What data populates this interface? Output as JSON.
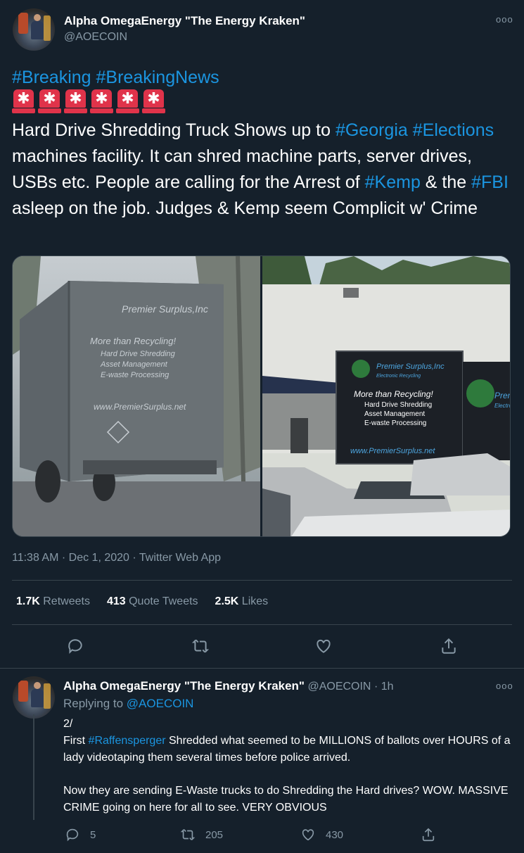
{
  "tweet": {
    "display_name": "Alpha OmegaEnergy \"The Energy Kraken\"",
    "handle": "@AOECOIN",
    "more": "ooo",
    "hashtags_line": [
      "#Breaking",
      "#BreakingNews"
    ],
    "alarm_emoji_count": 6,
    "body_parts": [
      {
        "t": "Hard Drive Shredding Truck Shows up to ",
        "link": false
      },
      {
        "t": "#Georgia",
        "link": true
      },
      {
        "t": " ",
        "link": false
      },
      {
        "t": "#Elections",
        "link": true
      },
      {
        "t": " machines facility. It can shred machine parts, server drives, USBs etc. People are calling for the Arrest of ",
        "link": false
      },
      {
        "t": "#Kemp",
        "link": true
      },
      {
        "t": " & the ",
        "link": false
      },
      {
        "t": "#FBI",
        "link": true
      },
      {
        "t": " asleep on the job. Judges & Kemp seem Complicit w' Crime",
        "link": false
      }
    ],
    "photo_left_text": {
      "company": "Premier Surplus,Inc",
      "tagline": "More than Recycling!",
      "services": [
        "Hard Drive Shredding",
        "Asset Management",
        "E-waste Processing"
      ],
      "website": "www.PremierSurplus.net"
    },
    "photo_right_text": {
      "company": "Premier Surplus,Inc",
      "sub": "Electronic Recycling",
      "tagline": "More than Recycling!",
      "services": [
        "Hard Drive Shredding",
        "Asset Management",
        "E-waste Processing"
      ],
      "website": "www.PremierSurplus.net",
      "side": "Premi",
      "side_sub": "Electroni"
    },
    "time": "11:38 AM",
    "date": "Dec 1, 2020",
    "app": "Twitter Web App",
    "stats": [
      {
        "value": "1.7K",
        "label": "Retweets"
      },
      {
        "value": "413",
        "label": "Quote Tweets"
      },
      {
        "value": "2.5K",
        "label": "Likes"
      }
    ],
    "actions": [
      "reply-icon",
      "retweet-icon",
      "like-icon",
      "share-icon"
    ]
  },
  "reply": {
    "display_name": "Alpha OmegaEnergy \"The Energy Kraken\"",
    "handle": "@AOECOIN",
    "age": "1h",
    "more": "ooo",
    "replying_to_label": "Replying to",
    "replying_to_handle": "@AOECOIN",
    "line1": "2/",
    "line2_pre": "First ",
    "line2_tag": "#Raffensperger",
    "line2_post": " Shredded what seemed to be MILLIONS of ballots over HOURS of a lady videotaping them several times before police arrived.",
    "line3": "Now they are sending E-Waste trucks to do Shredding the Hard drives? WOW. MASSIVE CRIME going on here for all to see. VERY OBVIOUS",
    "counts": {
      "replies": "5",
      "retweets": "205",
      "likes": "430"
    }
  },
  "colors": {
    "background": "#15202b",
    "link": "#1b95e0",
    "muted": "#8899a6",
    "border": "#38444d",
    "alarm": "#e0334a"
  }
}
